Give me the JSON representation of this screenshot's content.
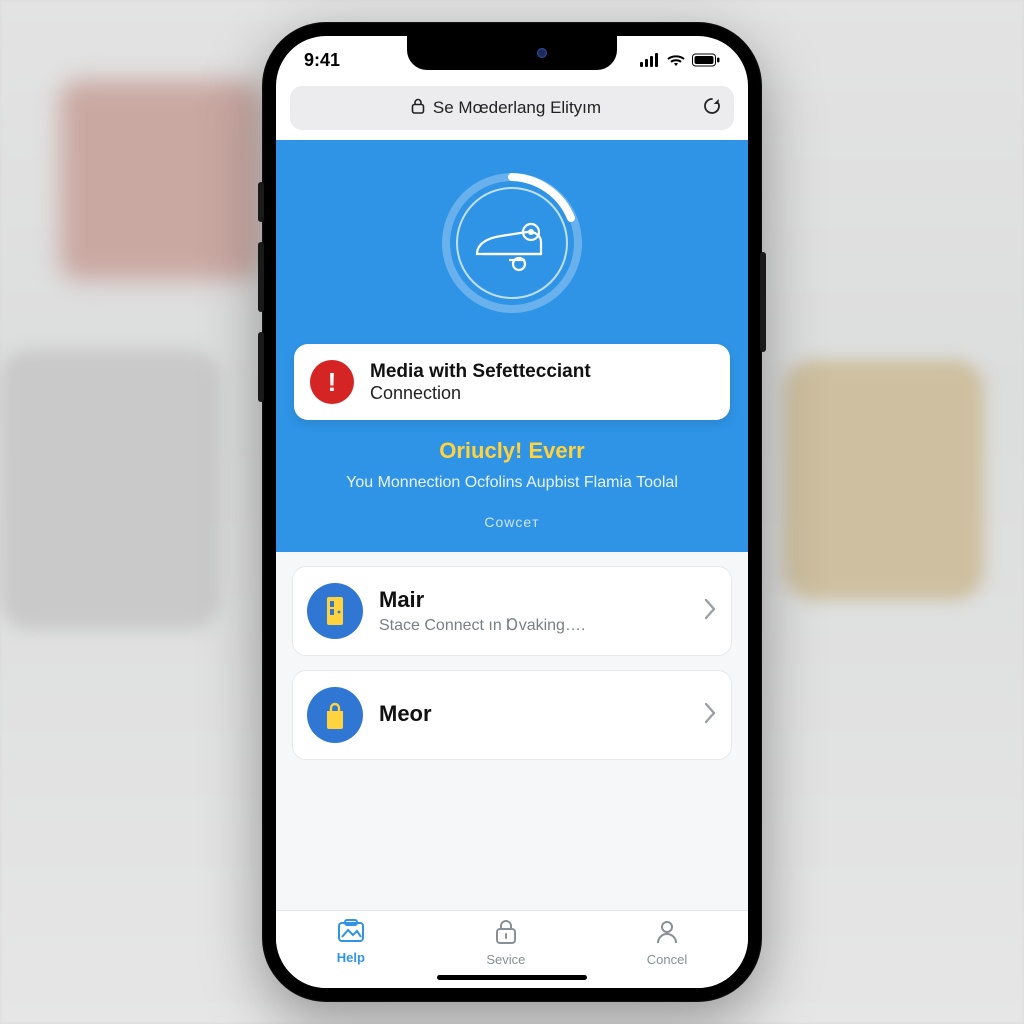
{
  "statusbar": {
    "time": "9:41"
  },
  "urlbar": {
    "text": "Se Mœderlang Elityım"
  },
  "hero": {
    "alert_line1": "Media with Sefettecciant",
    "alert_line2": "Connection",
    "headline": "Oriucly! Everr",
    "subline": "You Monnection Ocfolins Aupbist Flamia Toolal",
    "cancel": "Cowceт"
  },
  "list": {
    "items": [
      {
        "title": "Mair",
        "subtitle": "Stace Connect ın Ɒvaking…."
      },
      {
        "title": "Meor",
        "subtitle": ""
      }
    ]
  },
  "tabs": {
    "help": "Help",
    "sevice": "Sevice",
    "concel": "Concel"
  }
}
